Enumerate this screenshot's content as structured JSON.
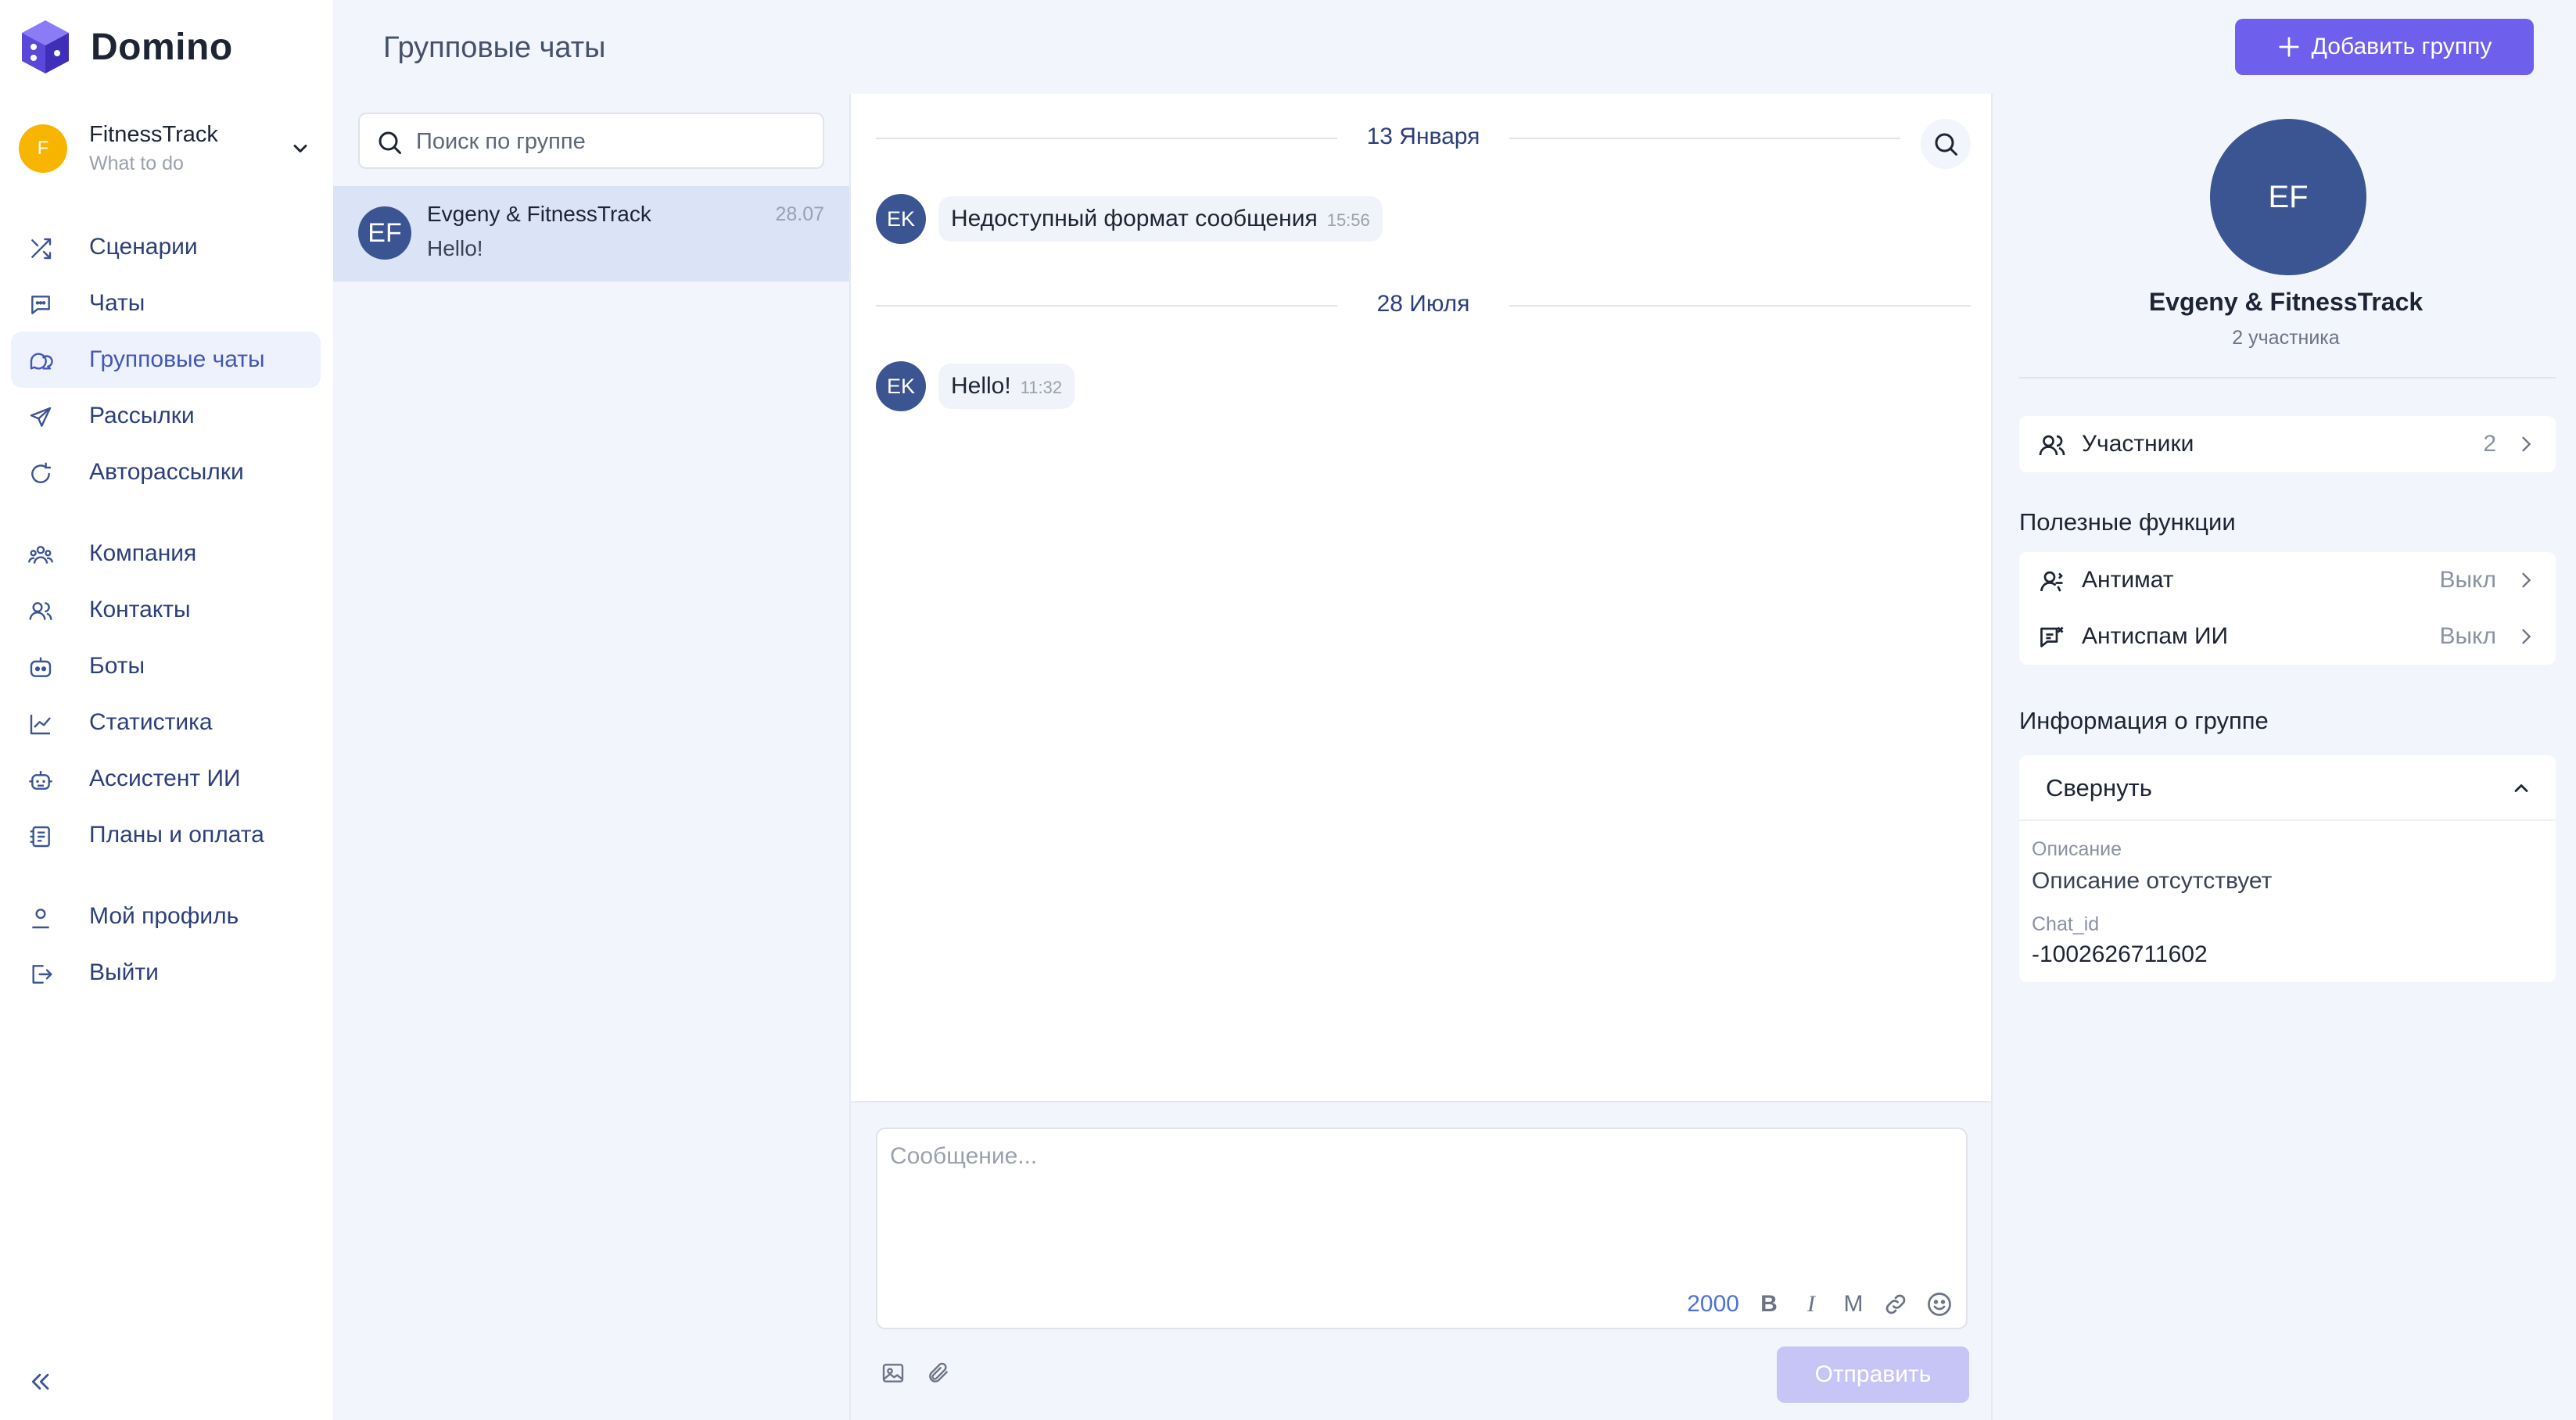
{
  "app": {
    "name": "Domino",
    "account": {
      "initial": "F",
      "name": "FitnessTrack",
      "subtitle": "What to do",
      "avatar_color": "#f8b500"
    }
  },
  "sidebar": {
    "groups": [
      [
        {
          "label": "Сценарии",
          "icon": "shuffle-icon"
        },
        {
          "label": "Чаты",
          "icon": "chat-bubble-icon"
        },
        {
          "label": "Групповые чаты",
          "icon": "group-chat-icon",
          "active": true
        },
        {
          "label": "Рассылки",
          "icon": "send-icon"
        },
        {
          "label": "Авторассылки",
          "icon": "auto-send-icon"
        }
      ],
      [
        {
          "label": "Компания",
          "icon": "company-icon"
        },
        {
          "label": "Контакты",
          "icon": "contacts-icon"
        },
        {
          "label": "Боты",
          "icon": "bot-icon"
        },
        {
          "label": "Статистика",
          "icon": "chart-icon"
        },
        {
          "label": "Ассистент ИИ",
          "icon": "ai-assistant-icon"
        },
        {
          "label": "Планы и оплата",
          "icon": "billing-icon"
        }
      ],
      [
        {
          "label": "Мой профиль",
          "icon": "user-icon"
        },
        {
          "label": "Выйти",
          "icon": "logout-icon"
        }
      ]
    ]
  },
  "header": {
    "title": "Групповые чаты",
    "add_button_label": "Добавить группу"
  },
  "chat_list": {
    "search_placeholder": "Поиск по группе",
    "items": [
      {
        "initials": "EF",
        "title": "Evgeny & FitnessTrack",
        "last_message": "Hello!",
        "date": "28.07",
        "selected": true
      }
    ]
  },
  "conversation": {
    "days": [
      {
        "date": "13 Января",
        "messages": [
          {
            "initials": "EK",
            "text": "Недоступный формат сообщения",
            "time": "15:56"
          }
        ]
      },
      {
        "date": "28 Июля",
        "messages": [
          {
            "initials": "EK",
            "text": "Hello!",
            "time": "11:32"
          }
        ]
      }
    ],
    "composer": {
      "placeholder": "Сообщение...",
      "char_counter": "2000",
      "format_buttons": [
        "B",
        "I",
        "M"
      ],
      "send_label": "Отправить"
    }
  },
  "group_info": {
    "initials": "EF",
    "name": "Evgeny & FitnessTrack",
    "members_count_text": "2 участника",
    "participants_label": "Участники",
    "participants_count": "2",
    "useful_functions_title": "Полезные функции",
    "functions": [
      {
        "label": "Антимат",
        "value": "Выкл",
        "icon": "antimat-icon"
      },
      {
        "label": "Антиспам ИИ",
        "value": "Выкл",
        "icon": "antispam-icon"
      }
    ],
    "info_title": "Информация о группе",
    "collapse_label": "Свернуть",
    "description_label": "Описание",
    "description_value": "Описание отсутствует",
    "chat_id_label": "Chat_id",
    "chat_id_value": "-1002626711602"
  },
  "colors": {
    "accent": "#6e60ed",
    "avatar": "#3b5592",
    "panel_bg": "#f2f5fb",
    "selected_bg": "#dbe4f7",
    "send_disabled": "#c7c4f6"
  }
}
